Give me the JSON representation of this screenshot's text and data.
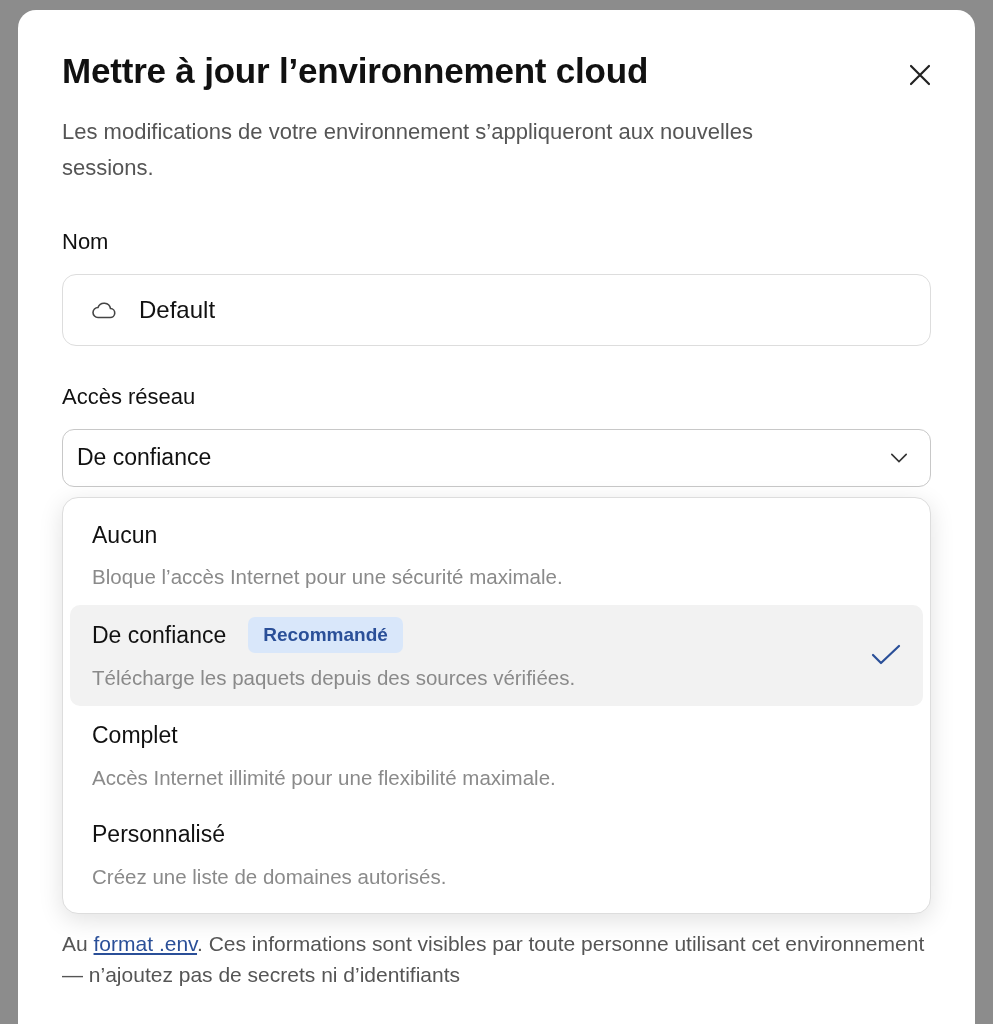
{
  "dialog": {
    "title": "Mettre à jour l’environnement cloud",
    "description": "Les modifications de votre environnement s’appliqueront aux nouvelles sessions.",
    "name_field": {
      "label": "Nom",
      "value": "Default"
    },
    "network_field": {
      "label": "Accès réseau",
      "value": "De confiance",
      "expanded": true,
      "options": [
        {
          "name": "Aucun",
          "description": "Bloque l’accès Internet pour une sécurité maximale.",
          "selected": false
        },
        {
          "name": "De confiance",
          "badge": "Recommandé",
          "description": "Télécharge les paquets depuis des sources vérifiées.",
          "selected": true
        },
        {
          "name": "Complet",
          "description": "Accès Internet illimité pour une flexibilité maximale.",
          "selected": false
        },
        {
          "name": "Personnalisé",
          "description": "Créez une liste de domaines autorisés.",
          "selected": false
        }
      ]
    },
    "help": {
      "before": "Au ",
      "link": "format .env",
      "after": ". Ces informations sont visibles par toute personne utilisant cet environnement — n’ajoutez pas de secrets ni d’identifiants"
    }
  }
}
